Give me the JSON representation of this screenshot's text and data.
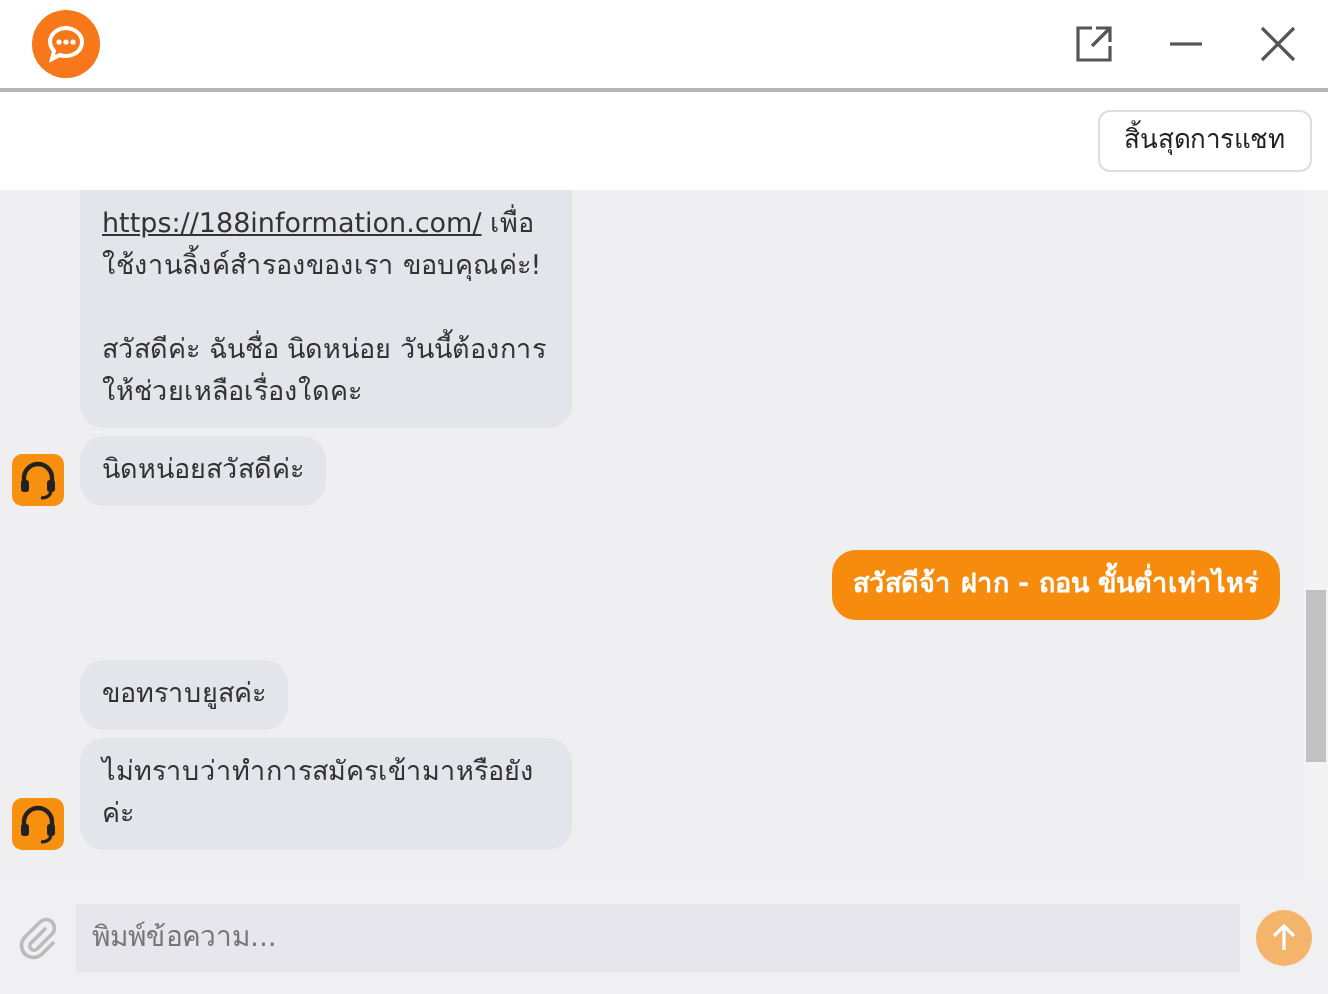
{
  "toolbar": {
    "end_chat_button": "สิ้นสุดการแชท"
  },
  "messages": [
    {
      "kind": "bot",
      "avatar": false,
      "paragraphs": [
        {
          "link": "https://188information.com/",
          "text": "เพื่อใช้งานลิ้งค์สำรองของเรา  ขอบคุณค่ะ!"
        },
        {
          "text": "สวัสดีค่ะ ฉันชื่อ นิดหน่อย วันนี้ต้องการให้ช่วยเหลือเรื่องใดคะ"
        }
      ]
    },
    {
      "kind": "bot",
      "avatar": true,
      "paragraphs": [
        {
          "text": "นิดหน่อยสวัสดีค่ะ"
        }
      ]
    },
    {
      "kind": "user",
      "paragraphs": [
        {
          "text": "สวัสดีจ้า ฝาก - ถอน ขั้นต่ำเท่าไหร่"
        }
      ]
    },
    {
      "kind": "bot",
      "avatar": false,
      "paragraphs": [
        {
          "text": "ขอทราบยูสค่ะ"
        }
      ]
    },
    {
      "kind": "bot",
      "avatar": true,
      "paragraphs": [
        {
          "text": "ไม่ทราบว่าทำการสมัครเข้ามาหรือยังค่ะ"
        }
      ]
    }
  ],
  "composer": {
    "placeholder": "พิมพ์ข้อความ...",
    "send_disabled": true
  }
}
